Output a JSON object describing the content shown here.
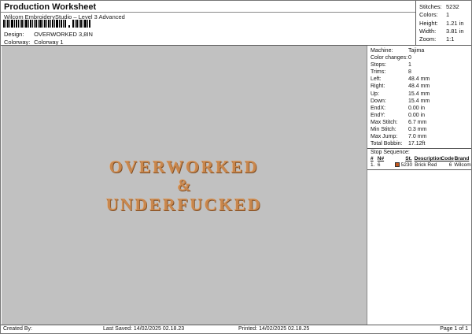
{
  "header": {
    "title": "Production Worksheet",
    "subtitle": "Wilcom EmbroideryStudio – Level 3 Advanced",
    "barcode_icon": "barcode",
    "design_label": "Design:",
    "design_value": "OVERWORKED 3,8IN",
    "colorway_label": "Colorway:",
    "colorway_value": "Colorway 1"
  },
  "stats": {
    "rows": [
      {
        "label": "Stitches:",
        "value": "5232"
      },
      {
        "label": "Colors:",
        "value": "1"
      },
      {
        "label": "Height:",
        "value": "1.21 in"
      },
      {
        "label": "Width:",
        "value": "3.81 in"
      },
      {
        "label": "Zoom:",
        "value": "1:1"
      }
    ]
  },
  "machine_info": {
    "rows": [
      {
        "label": "Machine:",
        "value": "Tajima"
      },
      {
        "label": "Color changes:",
        "value": "0"
      },
      {
        "label": "Stops:",
        "value": "1"
      },
      {
        "label": "Trims:",
        "value": "8"
      },
      {
        "label": "Left:",
        "value": "48.4 mm"
      },
      {
        "label": "Right:",
        "value": "48.4 mm"
      },
      {
        "label": "Up:",
        "value": "15.4 mm"
      },
      {
        "label": "Down:",
        "value": "15.4 mm"
      },
      {
        "label": "EndX:",
        "value": "0.00 in"
      },
      {
        "label": "EndY:",
        "value": "0.00 in"
      },
      {
        "label": "Max Stitch:",
        "value": "6.7 mm"
      },
      {
        "label": "Min Stitch:",
        "value": "0.3 mm"
      },
      {
        "label": "Max Jump:",
        "value": "7.0 mm"
      },
      {
        "label": "Total Bobbin:",
        "value": "17.12ft"
      }
    ]
  },
  "stop_sequence": {
    "title": "Stop Sequence:",
    "headers": [
      "#",
      "N#",
      "St.",
      "Description",
      "Code",
      "Brand"
    ],
    "row": {
      "num": "1.",
      "needle": "6",
      "stitches": "5230",
      "description": "Brick Red",
      "code": "6",
      "brand": "Wilcom",
      "swatch_color": "#c2571f"
    }
  },
  "design_preview": {
    "line1": "OVERWORKED",
    "line2": "&",
    "line3": "UNDERFUCKED",
    "thread_color": "#c8874e",
    "canvas_background": "#c1c1c1"
  },
  "footer": {
    "created_by": "Created By:",
    "last_saved": "Last Saved: 14/02/2025 02.18.23",
    "printed": "Printed: 14/02/2025 02.18.25",
    "page": "Page 1 of 1"
  }
}
